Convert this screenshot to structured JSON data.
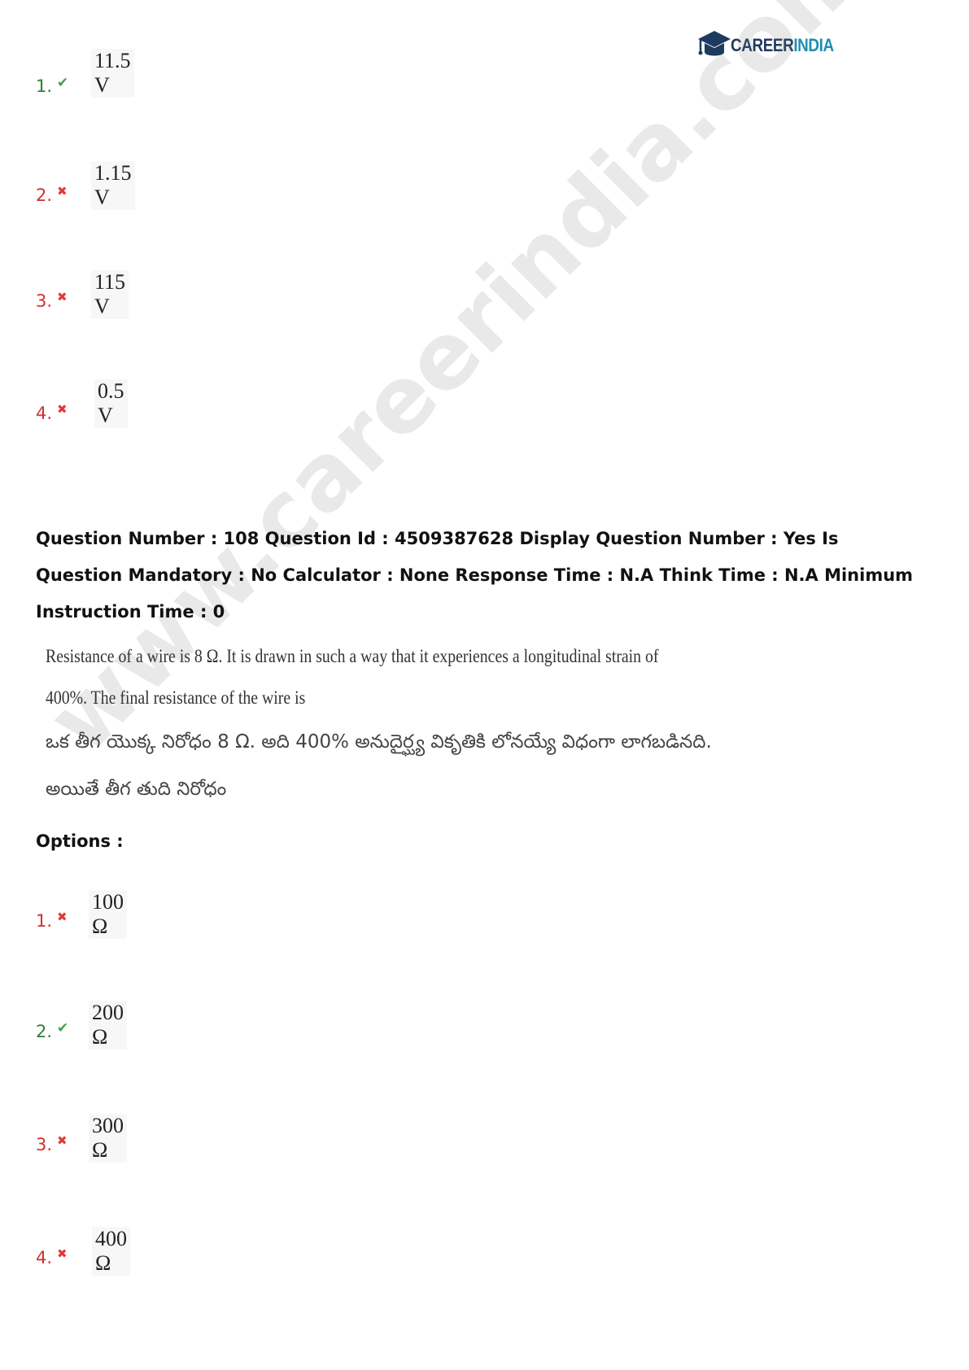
{
  "logo": {
    "text_main": "CAREER",
    "text_accent": "INDIA",
    "icon": "graduation-cap-icon",
    "colors": {
      "main": "#1f3a5f",
      "accent": "#1e8fb0"
    }
  },
  "watermark": "www.careerindia.com",
  "prev_options": [
    {
      "num": "1.",
      "value": "11.5 V",
      "status": "correct"
    },
    {
      "num": "2.",
      "value": "1.15 V",
      "status": "wrong"
    },
    {
      "num": "3.",
      "value": "115 V",
      "status": "wrong"
    },
    {
      "num": "4.",
      "value": "0.5 V",
      "status": "wrong"
    }
  ],
  "question": {
    "meta": "Question Number : 108 Question Id : 4509387628 Display Question Number : Yes Is Question Mandatory : No Calculator : None Response Time : N.A Think Time : N.A Minimum Instruction Time : 0",
    "english_line1": "Resistance of a wire is 8 Ω. It is drawn in such a way that it experiences a longitudinal strain of",
    "english_line2": "400%. The final resistance of the wire is",
    "telugu_line1": "ఒక తీగ యొక్క నిరోధం 8 Ω. అది 400% అనుదైర్ఘ్య వికృతికి లోనయ్యే విధంగా లాగబడినది.",
    "telugu_line2": "అయితే తీగ తుది నిరోధం",
    "options_label": "Options :"
  },
  "options": [
    {
      "num": "1.",
      "value": "100 Ω",
      "status": "wrong"
    },
    {
      "num": "2.",
      "value": "200 Ω",
      "status": "correct"
    },
    {
      "num": "3.",
      "value": "300 Ω",
      "status": "wrong"
    },
    {
      "num": "4.",
      "value": "400 Ω",
      "status": "wrong"
    }
  ],
  "marks": {
    "correct": "✔",
    "wrong": "✖"
  },
  "colors": {
    "correct": "#2e7d32",
    "wrong": "#d32f2f"
  }
}
